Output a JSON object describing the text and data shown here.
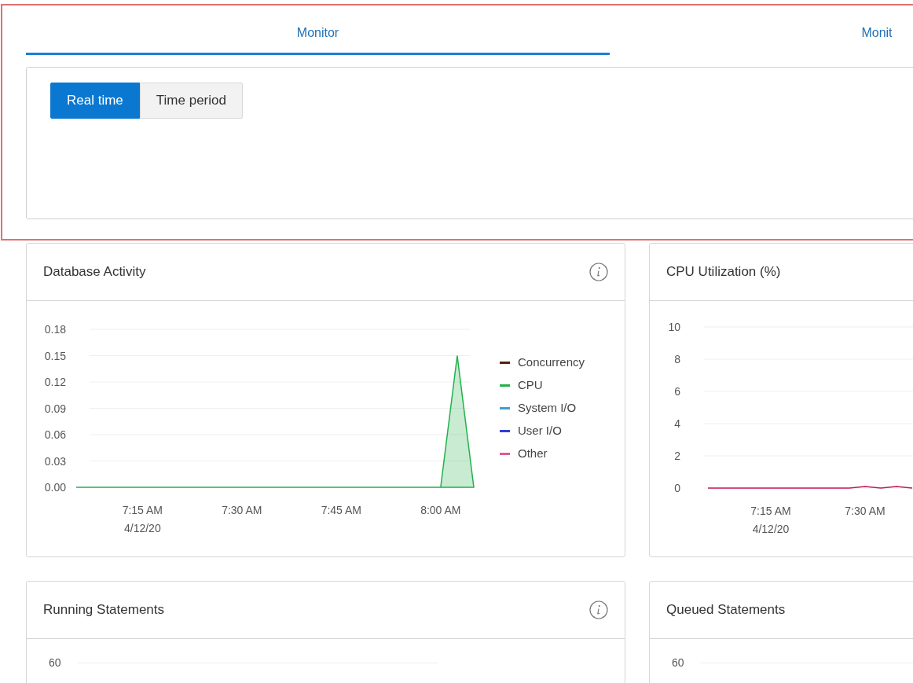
{
  "tabs": [
    {
      "label": "Monitor",
      "selected": true
    },
    {
      "label": "Monit",
      "selected": false
    }
  ],
  "mode_buttons": [
    {
      "label": "Real time",
      "selected": true
    },
    {
      "label": "Time period",
      "selected": false
    }
  ],
  "cards": [
    {
      "title": "Database Activity",
      "info_icon": true,
      "date_label": "4/12/20",
      "chart_data": {
        "type": "area",
        "grid": true,
        "ylim": [
          0,
          0.18
        ],
        "yticks": [
          {
            "value": 0,
            "label": "0.00"
          },
          {
            "value": 0.03,
            "label": "0.03"
          },
          {
            "value": 0.06,
            "label": "0.06"
          },
          {
            "value": 0.09,
            "label": "0.09"
          },
          {
            "value": 0.12,
            "label": "0.12"
          },
          {
            "value": 0.15,
            "label": "0.15"
          },
          {
            "value": 0.18,
            "label": "0.18"
          }
        ],
        "categories": [
          null,
          null,
          null,
          null,
          "7:15 AM",
          null,
          null,
          null,
          null,
          null,
          "7:30 AM",
          null,
          null,
          null,
          null,
          null,
          "7:45 AM",
          null,
          null,
          null,
          null,
          null,
          "8:00 AM",
          null,
          null
        ],
        "series": [
          {
            "color": "#22b14c",
            "values": [
              0,
              0,
              0,
              0,
              0,
              0,
              0,
              0,
              0,
              0,
              0,
              0,
              0,
              0,
              0,
              0,
              0,
              0,
              0,
              0,
              0,
              0,
              0,
              0.15,
              0
            ]
          }
        ]
      },
      "legend": [
        {
          "name": "Concurrency",
          "color": "#5a1e0a"
        },
        {
          "name": "CPU",
          "color": "#22b14c"
        },
        {
          "name": "System I/O",
          "color": "#3aa0d8"
        },
        {
          "name": "User I/O",
          "color": "#2f3fd8"
        },
        {
          "name": "Other",
          "color": "#e05a9a"
        }
      ]
    },
    {
      "title": "CPU Utilization (%)",
      "date_label": "4/12/20",
      "chart_data": {
        "type": "line",
        "grid": true,
        "ylim": [
          0,
          10
        ],
        "yticks": [
          {
            "value": 0,
            "label": "0"
          },
          {
            "value": 2,
            "label": "2"
          },
          {
            "value": 4,
            "label": "4"
          },
          {
            "value": 6,
            "label": "6"
          },
          {
            "value": 8,
            "label": "8"
          },
          {
            "value": 10,
            "label": "10"
          }
        ],
        "categories": [
          null,
          null,
          null,
          null,
          "7:15 AM",
          null,
          null,
          null,
          null,
          null,
          "7:30 AM",
          null,
          null,
          null
        ],
        "series": [
          {
            "color": "#c2185b",
            "values": [
              0,
              0,
              0,
              0,
              0,
              0,
              0,
              0,
              0,
              0,
              0.1,
              0,
              0.1,
              0
            ]
          }
        ]
      }
    },
    {
      "title": "Running Statements",
      "info_icon": true,
      "y_tick": "60"
    },
    {
      "title": "Queued Statements",
      "y_tick": "60"
    }
  ]
}
